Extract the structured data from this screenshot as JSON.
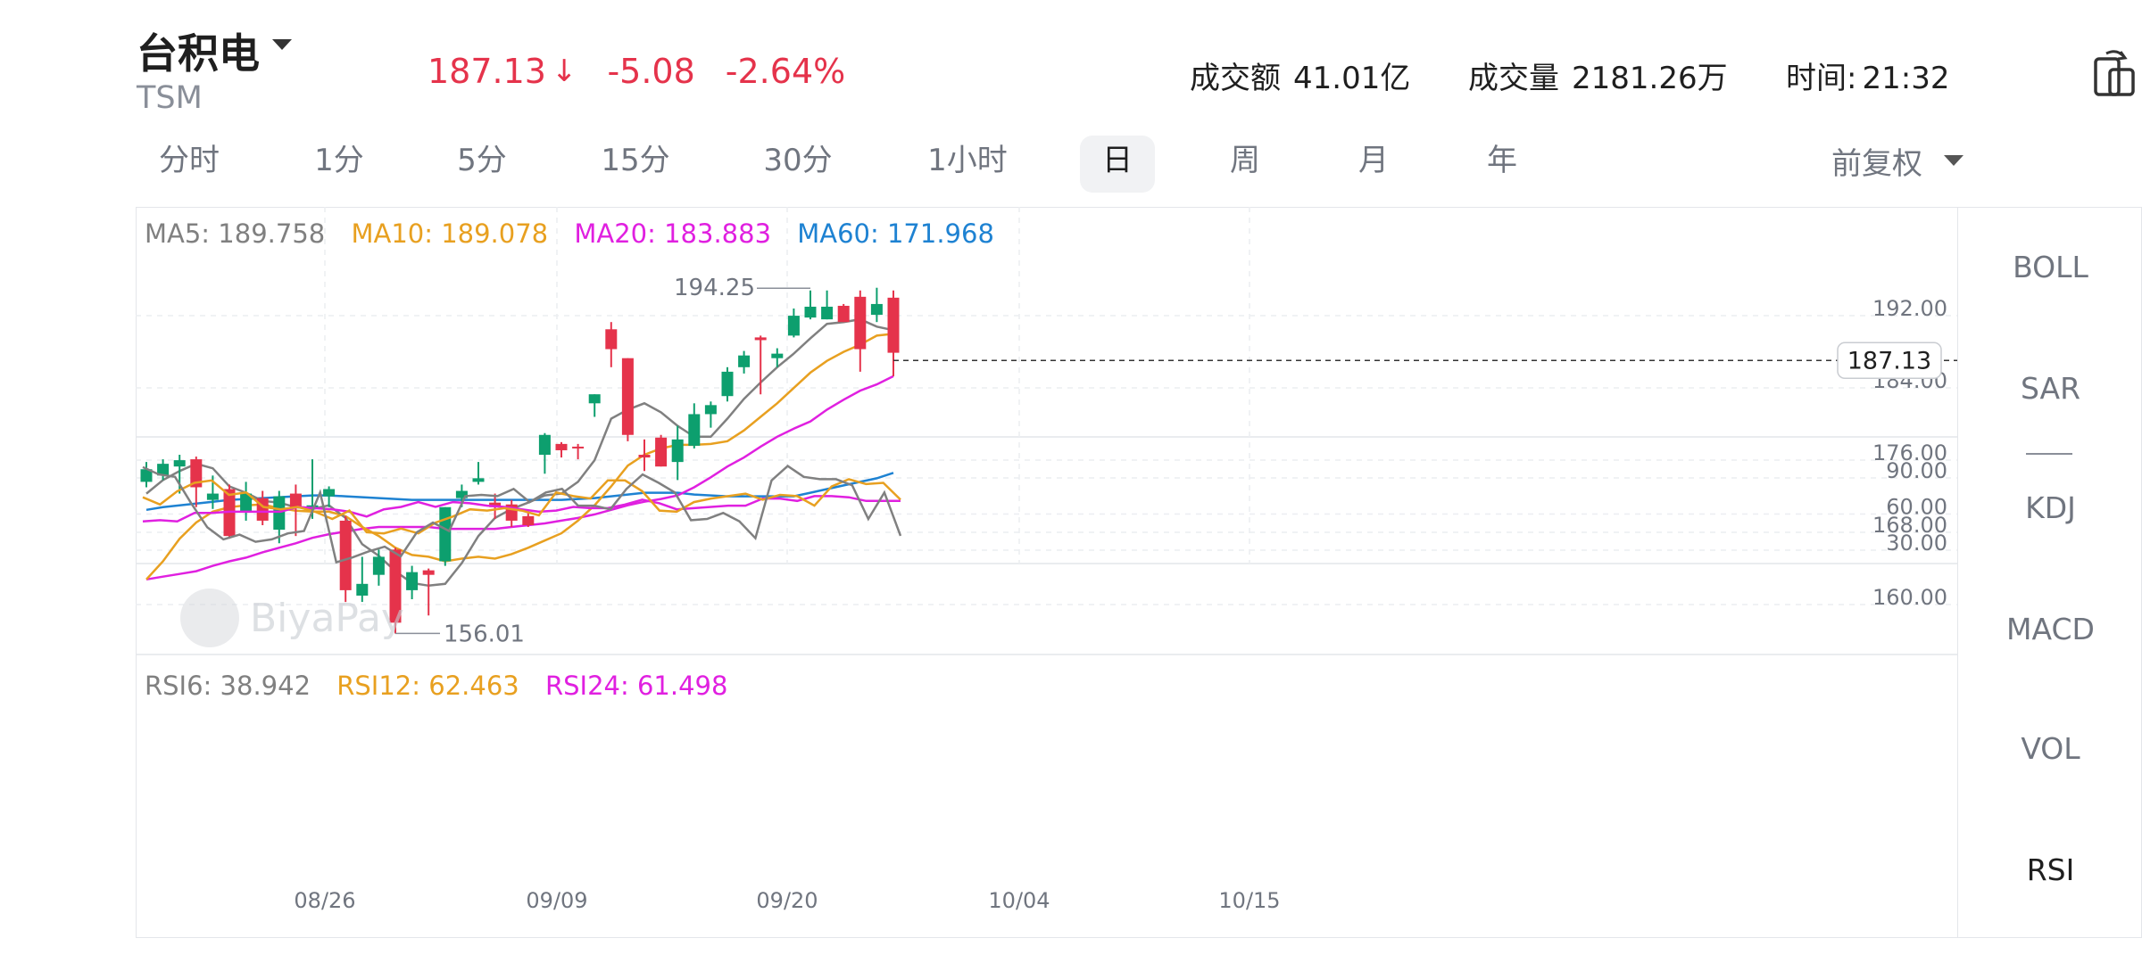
{
  "header": {
    "name": "台积电",
    "ticker": "TSM",
    "price": "187.13",
    "arrow": "↓",
    "change": "-5.08",
    "change_pct": "-2.64%",
    "turnover_label": "成交额",
    "turnover_value": "41.01亿",
    "volume_label": "成交量",
    "volume_value": "2181.26万",
    "time_label": "时间:",
    "time_value": "21:32",
    "down_color": "#e5334b",
    "up_color": "#0d9f6e"
  },
  "tabs": [
    "分时",
    "1分",
    "5分",
    "15分",
    "30分",
    "1小时",
    "日",
    "周",
    "月",
    "年"
  ],
  "active_tab": "日",
  "adjust_label": "前复权",
  "ma_legend": {
    "ma5": "MA5: 189.758",
    "ma10": "MA10: 189.078",
    "ma20": "MA20: 183.883",
    "ma60": "MA60: 171.968",
    "colors": {
      "ma5": "#808080",
      "ma10": "#e8a020",
      "ma20": "#e020e0",
      "ma60": "#1e82d2"
    }
  },
  "rsi_legend": {
    "rsi6": "RSI6: 38.942",
    "rsi12": "RSI12: 62.463",
    "rsi24": "RSI24: 61.498"
  },
  "indicators": [
    "BOLL",
    "SAR",
    "KDJ",
    "MACD",
    "VOL",
    "RSI"
  ],
  "active_indicator": "RSI",
  "watermark": "BiyaPay",
  "chart_data": {
    "type": "candlestick",
    "price_axis_ticks": [
      "192.00",
      "184.00",
      "176.00",
      "168.00",
      "160.00"
    ],
    "rsi_axis_ticks": [
      "90.00",
      "60.00",
      "30.00"
    ],
    "date_ticks": [
      "08/26",
      "09/09",
      "09/20",
      "10/04",
      "10/15"
    ],
    "last_price_label": "187.13",
    "high_label": "194.25",
    "low_label": "156.01",
    "candles": [
      {
        "o": 172.8,
        "c": 174.2,
        "h": 175.0,
        "l": 172.2
      },
      {
        "o": 173.5,
        "c": 174.8,
        "h": 175.3,
        "l": 173.0
      },
      {
        "o": 174.5,
        "c": 175.2,
        "h": 175.8,
        "l": 171.5
      },
      {
        "o": 175.3,
        "c": 172.2,
        "h": 175.6,
        "l": 170.0
      },
      {
        "o": 170.8,
        "c": 171.5,
        "h": 173.5,
        "l": 169.8
      },
      {
        "o": 172.0,
        "c": 166.8,
        "h": 172.5,
        "l": 166.5
      },
      {
        "o": 169.5,
        "c": 171.5,
        "h": 172.8,
        "l": 168.5
      },
      {
        "o": 171.0,
        "c": 168.5,
        "h": 171.8,
        "l": 168.0
      },
      {
        "o": 167.5,
        "c": 171.2,
        "h": 171.8,
        "l": 166.0
      },
      {
        "o": 171.5,
        "c": 170.0,
        "h": 172.5,
        "l": 166.8
      },
      {
        "o": 169.8,
        "c": 170.2,
        "h": 175.3,
        "l": 168.7
      },
      {
        "o": 171.2,
        "c": 172.0,
        "h": 172.3,
        "l": 170.0
      },
      {
        "o": 168.5,
        "c": 160.8,
        "h": 169.0,
        "l": 159.5
      },
      {
        "o": 160.2,
        "c": 161.5,
        "h": 164.5,
        "l": 159.5
      },
      {
        "o": 162.5,
        "c": 164.5,
        "h": 165.3,
        "l": 161.3
      },
      {
        "o": 165.3,
        "c": 157.2,
        "h": 165.5,
        "l": 156.0
      },
      {
        "o": 160.8,
        "c": 162.8,
        "h": 163.5,
        "l": 159.8
      },
      {
        "o": 163.0,
        "c": 162.5,
        "h": 163.2,
        "l": 158.0
      },
      {
        "o": 164.0,
        "c": 170.0,
        "h": 170.0,
        "l": 163.5
      },
      {
        "o": 171.0,
        "c": 171.8,
        "h": 172.5,
        "l": 170.0
      },
      {
        "o": 172.8,
        "c": 173.2,
        "h": 175.0,
        "l": 172.5
      },
      {
        "o": 170.5,
        "c": 170.0,
        "h": 171.5,
        "l": 168.7
      },
      {
        "o": 170.3,
        "c": 168.5,
        "h": 170.8,
        "l": 167.8
      },
      {
        "o": 169.0,
        "c": 168.0,
        "h": 169.5,
        "l": 167.8
      },
      {
        "o": 175.8,
        "c": 178.0,
        "h": 178.2,
        "l": 173.7
      },
      {
        "o": 177.0,
        "c": 176.3,
        "h": 177.2,
        "l": 175.5
      },
      {
        "o": 176.7,
        "c": 176.5,
        "h": 177.0,
        "l": 175.3
      },
      {
        "o": 181.5,
        "c": 182.5,
        "h": 182.5,
        "l": 180.0
      },
      {
        "o": 189.7,
        "c": 187.5,
        "h": 190.5,
        "l": 185.5
      },
      {
        "o": 186.5,
        "c": 178.0,
        "h": 186.5,
        "l": 177.3
      },
      {
        "o": 175.8,
        "c": 175.5,
        "h": 177.5,
        "l": 174.0
      },
      {
        "o": 177.7,
        "c": 174.5,
        "h": 178.0,
        "l": 174.5
      },
      {
        "o": 175.0,
        "c": 177.5,
        "h": 179.0,
        "l": 173.0
      },
      {
        "o": 176.8,
        "c": 180.3,
        "h": 181.5,
        "l": 176.5
      },
      {
        "o": 180.3,
        "c": 181.3,
        "h": 181.7,
        "l": 178.8
      },
      {
        "o": 182.3,
        "c": 185.0,
        "h": 185.5,
        "l": 181.7
      },
      {
        "o": 185.5,
        "c": 186.8,
        "h": 187.3,
        "l": 184.8
      },
      {
        "o": 188.8,
        "c": 188.5,
        "h": 189.0,
        "l": 182.5
      },
      {
        "o": 186.5,
        "c": 187.0,
        "h": 187.6,
        "l": 185.5
      },
      {
        "o": 189.0,
        "c": 191.2,
        "h": 192.0,
        "l": 188.8
      },
      {
        "o": 191.0,
        "c": 192.2,
        "h": 194.0,
        "l": 190.8
      },
      {
        "o": 190.8,
        "c": 192.2,
        "h": 194.0,
        "l": 190.8
      },
      {
        "o": 192.3,
        "c": 190.5,
        "h": 192.5,
        "l": 190.5
      },
      {
        "o": 193.3,
        "c": 187.5,
        "h": 194.0,
        "l": 185.0
      },
      {
        "o": 191.3,
        "c": 192.5,
        "h": 194.3,
        "l": 190.5
      },
      {
        "o": 193.2,
        "c": 187.1,
        "h": 194.0,
        "l": 184.5
      }
    ],
    "ma5": [
      171.5,
      173.0,
      174.0,
      174.8,
      174.3,
      172.3,
      171.6,
      170.7,
      170.5,
      170.0,
      169.8,
      170.2,
      168.8,
      165.9,
      164.6,
      162.9,
      161.6,
      161.3,
      161.5,
      163.8,
      166.8,
      168.8,
      169.8,
      170.5,
      171.3,
      171.5,
      172.8,
      175.2,
      179.8,
      180.8,
      181.5,
      180.5,
      179.0,
      177.8,
      177.8,
      179.8,
      182.0,
      183.8,
      185.5,
      187.0,
      188.7,
      190.3,
      190.5,
      190.8,
      190.0,
      189.6
    ],
    "ma10": [
      162.0,
      164.0,
      166.5,
      168.3,
      169.5,
      170.0,
      170.2,
      170.3,
      169.9,
      169.6,
      169.5,
      169.5,
      169.0,
      167.8,
      166.8,
      165.5,
      164.7,
      164.5,
      164.0,
      164.3,
      164.5,
      164.3,
      164.8,
      165.5,
      166.3,
      167.1,
      168.5,
      170.2,
      172.3,
      174.6,
      175.8,
      176.5,
      176.9,
      176.9,
      177.0,
      177.3,
      178.5,
      180.0,
      181.5,
      183.2,
      184.9,
      186.2,
      187.2,
      188.0,
      189.0,
      189.2
    ],
    "ma20": [
      162.0,
      162.3,
      162.6,
      162.9,
      163.5,
      164.0,
      164.4,
      165.0,
      165.5,
      166.0,
      166.6,
      167.0,
      167.3,
      167.6,
      167.8,
      167.8,
      167.8,
      167.8,
      167.6,
      167.6,
      167.6,
      167.6,
      167.8,
      168.0,
      168.2,
      168.5,
      168.8,
      169.2,
      169.7,
      170.2,
      170.6,
      170.9,
      171.3,
      172.2,
      173.3,
      174.5,
      175.5,
      176.7,
      177.8,
      178.7,
      179.5,
      180.8,
      181.9,
      182.9,
      183.6,
      184.5
    ],
    "ma60": [
      169.7,
      170.0,
      170.2,
      170.4,
      170.6,
      170.8,
      170.9,
      171.0,
      171.1,
      171.2,
      171.3,
      171.3,
      171.2,
      171.1,
      171.0,
      170.9,
      170.8,
      170.8,
      170.8,
      170.8,
      170.8,
      170.8,
      170.8,
      170.8,
      170.8,
      170.8,
      170.9,
      171.0,
      171.2,
      171.4,
      171.6,
      171.6,
      171.6,
      171.4,
      171.3,
      171.2,
      171.2,
      171.2,
      171.2,
      171.2,
      171.6,
      172.0,
      172.4,
      172.8,
      173.2,
      173.8
    ],
    "rsi6": [
      93,
      87,
      85,
      63,
      43,
      33,
      37,
      31,
      33,
      38,
      40,
      72,
      14,
      18,
      23,
      27,
      19,
      39,
      47,
      40,
      69,
      70,
      69,
      75,
      64,
      72,
      75,
      61,
      61,
      58,
      75,
      87,
      80,
      72,
      49,
      50,
      55,
      48,
      34,
      82,
      94,
      85,
      83,
      83,
      78,
      50,
      72,
      36
    ],
    "rsi12": [
      68,
      62,
      73,
      80,
      82,
      70,
      72,
      60,
      58,
      60,
      56,
      50,
      57,
      39,
      38,
      42,
      38,
      47,
      52,
      58,
      57,
      59,
      57,
      53,
      72,
      69,
      67,
      82,
      82,
      73,
      57,
      56,
      64,
      67,
      69,
      71,
      66,
      70,
      69,
      61,
      77,
      83,
      79,
      80,
      66
    ],
    "rsi24": [
      48,
      49,
      48,
      55,
      55,
      56,
      56,
      56,
      56,
      60,
      59,
      58,
      56,
      52,
      58,
      60,
      64,
      60,
      64,
      63,
      61,
      60,
      58,
      56,
      57,
      60,
      59,
      59,
      62,
      66,
      63,
      58,
      59,
      60,
      61,
      61,
      67,
      67,
      65,
      69,
      69,
      68,
      65,
      65,
      65
    ]
  }
}
